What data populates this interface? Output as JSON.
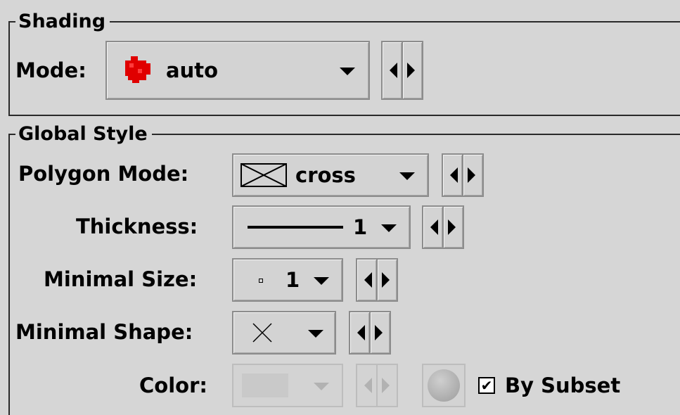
{
  "shading": {
    "title": "Shading",
    "mode_label": "Mode:",
    "mode_value": "auto",
    "mode_icon": "red-blob-icon"
  },
  "global_style": {
    "title": "Global Style",
    "polygon_mode": {
      "label": "Polygon Mode:",
      "value": "cross",
      "icon": "crossed-box-icon"
    },
    "thickness": {
      "label": "Thickness:",
      "value": "1",
      "icon": "line-icon"
    },
    "minimal_size": {
      "label": "Minimal Size:",
      "value": "1",
      "icon": "dot-icon"
    },
    "minimal_shape": {
      "label": "Minimal Shape:",
      "icon": "x-shape-icon"
    },
    "color": {
      "label": "Color:",
      "enabled": false
    },
    "by_subset": {
      "label": "By Subset",
      "checked": true
    }
  },
  "colors": {
    "background": "#d6d6d6",
    "shading_red": "#e00000"
  }
}
